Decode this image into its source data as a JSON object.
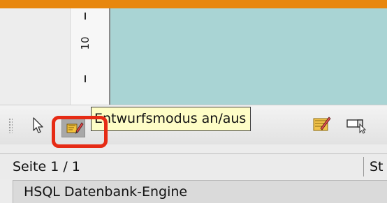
{
  "ruler": {
    "label": "10"
  },
  "toolbar": {
    "pointer_icon": "select-pointer-icon",
    "design_mode_icon": "design-mode-icon",
    "tooltip": "Entwurfsmodus an/aus",
    "extra_icons": [
      "form-wizard-icon",
      "control-insert-icon"
    ]
  },
  "status": {
    "page": "Seite 1 / 1",
    "next": "St",
    "engine": "HSQL Datenbank-Engine"
  },
  "colors": {
    "accent": "#e8870e",
    "canvas": "#a9d4d4",
    "highlight": "#e62b15",
    "tooltip_bg": "#fefdc6"
  }
}
